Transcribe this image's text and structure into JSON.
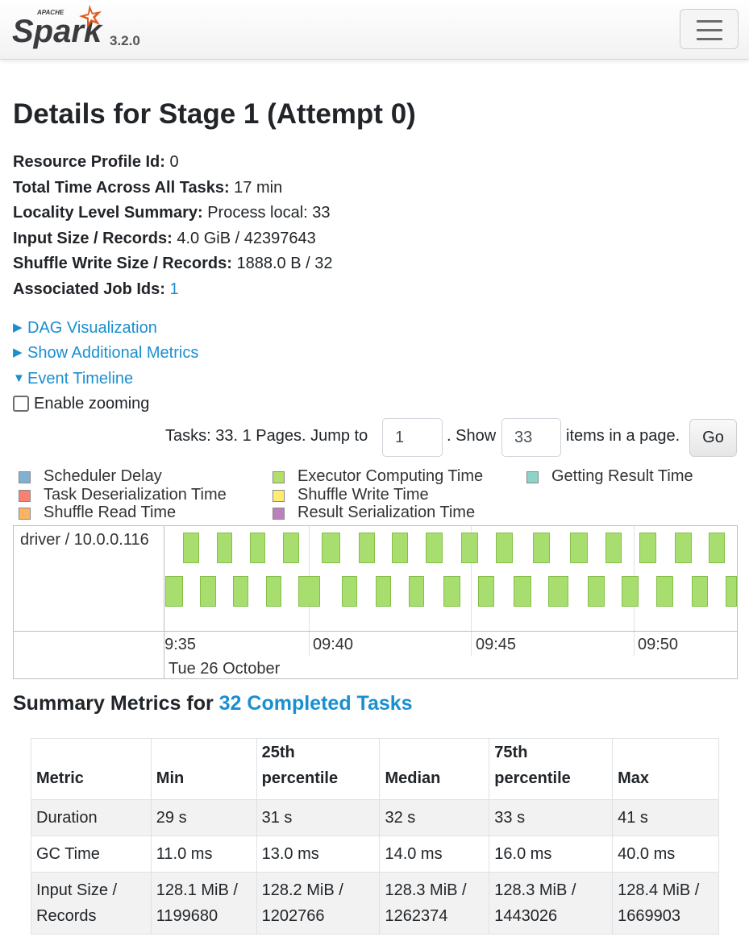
{
  "app": {
    "logo_top": "APACHE",
    "logo_main": "Spark",
    "version": "3.2.0",
    "menu_icon": "hamburger-icon"
  },
  "page": {
    "title": "Details for Stage 1 (Attempt 0)"
  },
  "summary": {
    "resource_profile": {
      "label": "Resource Profile Id:",
      "value": "0"
    },
    "total_time": {
      "label": "Total Time Across All Tasks:",
      "value": "17 min"
    },
    "locality": {
      "label": "Locality Level Summary:",
      "value": "Process local: 33"
    },
    "input": {
      "label": "Input Size / Records:",
      "value": "4.0 GiB / 42397643"
    },
    "shuffle_write": {
      "label": "Shuffle Write Size / Records:",
      "value": "1888.0 B / 32"
    },
    "job_ids": {
      "label": "Associated Job Ids:",
      "value": "1"
    }
  },
  "expanders": {
    "dag": "DAG Visualization",
    "metrics": "Show Additional Metrics",
    "timeline": "Event Timeline"
  },
  "zoom": {
    "label": "Enable zooming",
    "checked": false
  },
  "pagination": {
    "prefix": "Tasks: 33. 1 Pages. Jump to",
    "page_value": "1",
    "show_label": ". Show",
    "size_value": "33",
    "suffix": "items in a page.",
    "go": "Go"
  },
  "legend": [
    {
      "label": "Scheduler Delay",
      "color": "#80b1d3"
    },
    {
      "label": "Task Deserialization Time",
      "color": "#fb8072"
    },
    {
      "label": "Shuffle Read Time",
      "color": "#fdb462"
    },
    {
      "label": "Executor Computing Time",
      "color": "#b3de69"
    },
    {
      "label": "Shuffle Write Time",
      "color": "#ffed6f"
    },
    {
      "label": "Result Serialization Time",
      "color": "#bc80bd"
    },
    {
      "label": "Getting Result Time",
      "color": "#8dd3c7"
    }
  ],
  "timeline": {
    "group": "driver / 10.0.0.116",
    "ticks": [
      "09:35",
      "09:40",
      "09:45",
      "09:50"
    ],
    "date": "Tue 26 October",
    "task_color": "#a8de6f"
  },
  "metrics": {
    "title_prefix": "Summary Metrics for",
    "title_link": "32 Completed Tasks",
    "headers": [
      "Metric",
      "Min",
      "25th percentile",
      "Median",
      "75th percentile",
      "Max"
    ],
    "rows": [
      [
        "Duration",
        "29 s",
        "31 s",
        "32 s",
        "33 s",
        "41 s"
      ],
      [
        "GC Time",
        "11.0 ms",
        "13.0 ms",
        "14.0 ms",
        "16.0 ms",
        "40.0 ms"
      ],
      [
        "Input Size / Records",
        "128.1 MiB / 1199680",
        "128.2 MiB / 1202766",
        "128.3 MiB / 1262374",
        "128.3 MiB / 1443026",
        "128.4 MiB / 1669903"
      ]
    ]
  }
}
